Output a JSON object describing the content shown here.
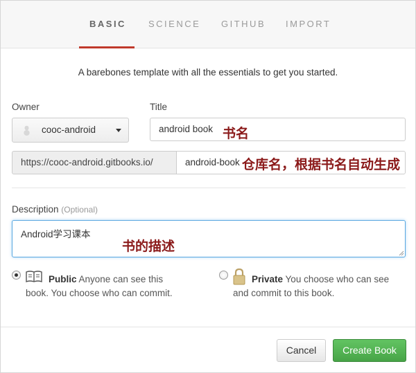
{
  "tabs": [
    {
      "label": "BASIC",
      "active": true
    },
    {
      "label": "SCIENCE",
      "active": false
    },
    {
      "label": "GITHUB",
      "active": false
    },
    {
      "label": "IMPORT",
      "active": false
    }
  ],
  "intro": "A barebones template with all the essentials to get you started.",
  "owner": {
    "label": "Owner",
    "value": "cooc-android",
    "icon": "user-avatar-icon"
  },
  "title": {
    "label": "Title",
    "value": "android book"
  },
  "url": {
    "prefix": "https://cooc-android.gitbooks.io/",
    "value": "android-book"
  },
  "description": {
    "label": "Description",
    "optional": "(Optional)",
    "value": "Android学习课本"
  },
  "visibility": {
    "public": {
      "title": "Public",
      "text_line1": "Anyone can see this",
      "text_line2": "book. You choose who can commit.",
      "checked": true,
      "icon": "book-icon"
    },
    "private": {
      "title": "Private",
      "text_line1": "You choose who can see",
      "text_line2": "and commit to this book.",
      "checked": false,
      "icon": "lock-icon"
    }
  },
  "annotations": {
    "title_note": "书名",
    "url_note": "仓库名，根据书名自动生成",
    "desc_note": "书的描述"
  },
  "buttons": {
    "cancel": "Cancel",
    "create": "Create Book"
  },
  "colors": {
    "accent": "#c0392b",
    "primary_button": "#4cae4c",
    "annotation": "#8b1a1a",
    "focus": "#5aa8e0"
  }
}
